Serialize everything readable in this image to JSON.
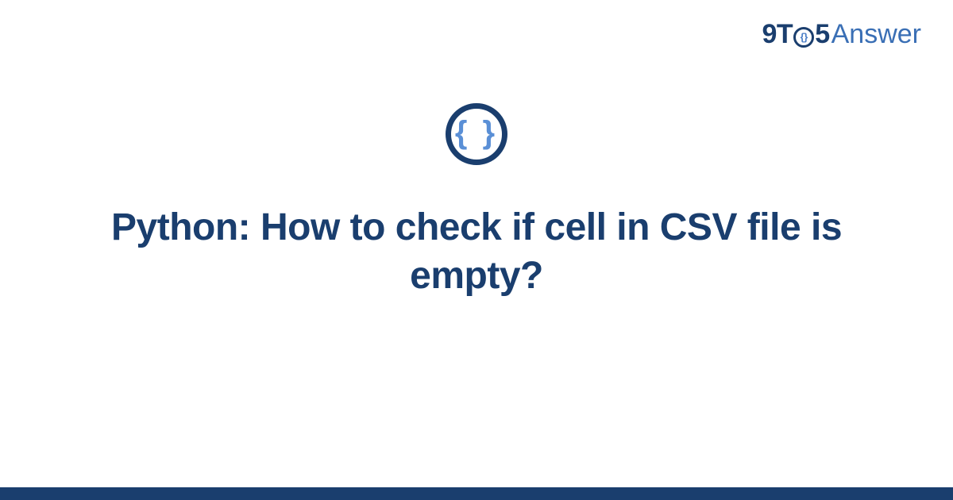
{
  "brand": {
    "prefix": "9T",
    "middle_glyph": "{}",
    "suffix": "5",
    "word": "Answer"
  },
  "icon": {
    "glyph": "{ }",
    "name": "code-braces-icon"
  },
  "title": "Python: How to check if cell in CSV file is empty?",
  "colors": {
    "primary": "#1a3e6e",
    "accent": "#3a6fb5",
    "icon_inner": "#5a8fd6"
  }
}
